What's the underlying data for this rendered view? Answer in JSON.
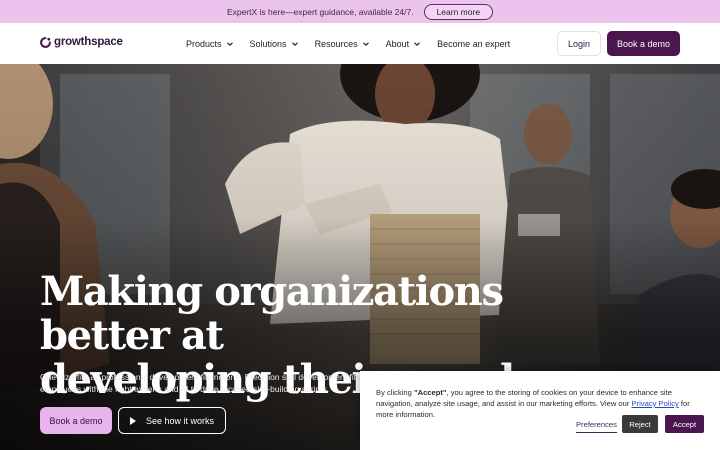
{
  "announcement": {
    "text": "ExpertX is here—expert guidance, available 24/7.",
    "button_label": "Learn more"
  },
  "header": {
    "brand": "growthspace",
    "nav": [
      {
        "label": "Products",
        "has_dropdown": true
      },
      {
        "label": "Solutions",
        "has_dropdown": true
      },
      {
        "label": "Resources",
        "has_dropdown": true
      },
      {
        "label": "About",
        "has_dropdown": true
      },
      {
        "label": "Become an expert",
        "has_dropdown": false
      }
    ],
    "login_label": "Login",
    "demo_label": "Book a demo"
  },
  "hero": {
    "title_line1": "Making organizations better at",
    "title_line2": "developing their people",
    "subtitle_line1": "One-size-fits-all professional development fits no one. Precision skill development fits pe",
    "subtitle_line2": "employees with the right experts and AI to drive focused skill-building sprints.",
    "cta_primary": "Book a demo",
    "cta_secondary": "See how it works"
  },
  "cookie": {
    "text_before": "By clicking ",
    "text_bold": "\"Accept\"",
    "text_middle": ", you agree to the storing of cookies on your device to enhance site navigation, analyze site usage, and assist in our marketing efforts. View our ",
    "policy_link": "Privacy Policy",
    "text_after": " for more information.",
    "preferences_label": "Preferences",
    "reject_label": "Reject",
    "accept_label": "Accept"
  },
  "colors": {
    "announcement_bg": "#ecc3ec",
    "brand_purple": "#4b1650",
    "cta_pink": "#e9b3ee"
  }
}
